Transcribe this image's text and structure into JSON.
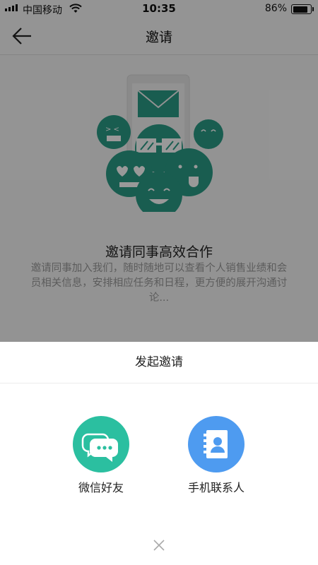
{
  "status_bar": {
    "carrier": "中国移动",
    "time": "10:35",
    "battery_percent": "86%",
    "battery_level": 0.86
  },
  "nav": {
    "title": "邀请",
    "back_icon": "arrow-left-icon"
  },
  "main": {
    "headline": "邀请同事高效合作",
    "description": "邀请同事加入我们，随时随地可以查看个人销售业绩和会员相关信息，安排相应任务和日程，更方便的展开沟通讨论..."
  },
  "sheet": {
    "title": "发起邀请",
    "options": [
      {
        "label": "微信好友",
        "icon": "wechat-chat-icon",
        "color": "#2bbfa0"
      },
      {
        "label": "手机联系人",
        "icon": "contacts-book-icon",
        "color": "#4e9bf0"
      }
    ],
    "close_icon": "close-icon"
  },
  "colors": {
    "accent_teal": "#2a9c86",
    "overlay": "rgba(0,0,0,0.4)"
  }
}
